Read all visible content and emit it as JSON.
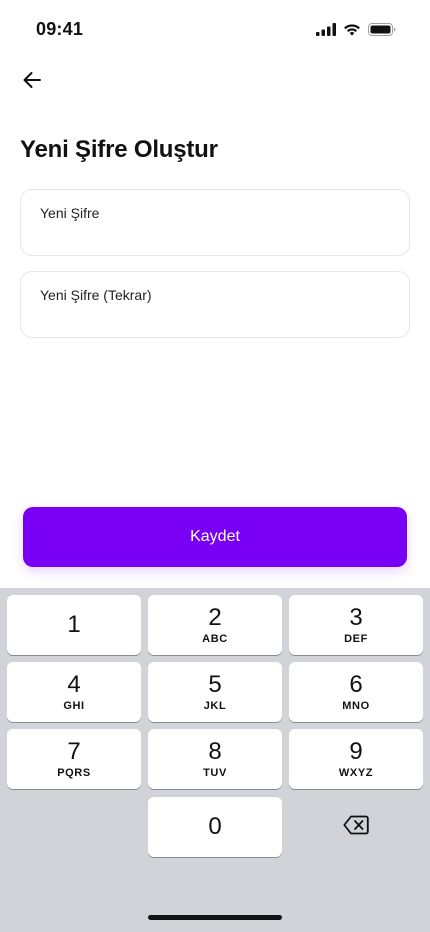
{
  "status_bar": {
    "time": "09:41",
    "icons": [
      "cellular-signal-icon",
      "wifi-icon",
      "battery-icon"
    ]
  },
  "header": {
    "back_icon": "arrow-left-icon",
    "title": "Yeni Şifre Oluştur"
  },
  "form": {
    "new_password_placeholder": "Yeni Şifre",
    "new_password_value": "",
    "confirm_password_placeholder": "Yeni Şifre (Tekrar)",
    "confirm_password_value": "",
    "save_label": "Kaydet"
  },
  "keypad": {
    "keys": [
      {
        "digit": "1",
        "letters": ""
      },
      {
        "digit": "2",
        "letters": "ABC"
      },
      {
        "digit": "3",
        "letters": "DEF"
      },
      {
        "digit": "4",
        "letters": "GHI"
      },
      {
        "digit": "5",
        "letters": "JKL"
      },
      {
        "digit": "6",
        "letters": "MNO"
      },
      {
        "digit": "7",
        "letters": "PQRS"
      },
      {
        "digit": "8",
        "letters": "TUV"
      },
      {
        "digit": "9",
        "letters": "WXYZ"
      },
      {
        "digit": "0",
        "letters": ""
      }
    ],
    "delete_icon": "backspace-icon"
  },
  "colors": {
    "accent": "#7a00f5",
    "keypad_background": "#d1d3d9",
    "field_border": "#e6e6ea"
  }
}
